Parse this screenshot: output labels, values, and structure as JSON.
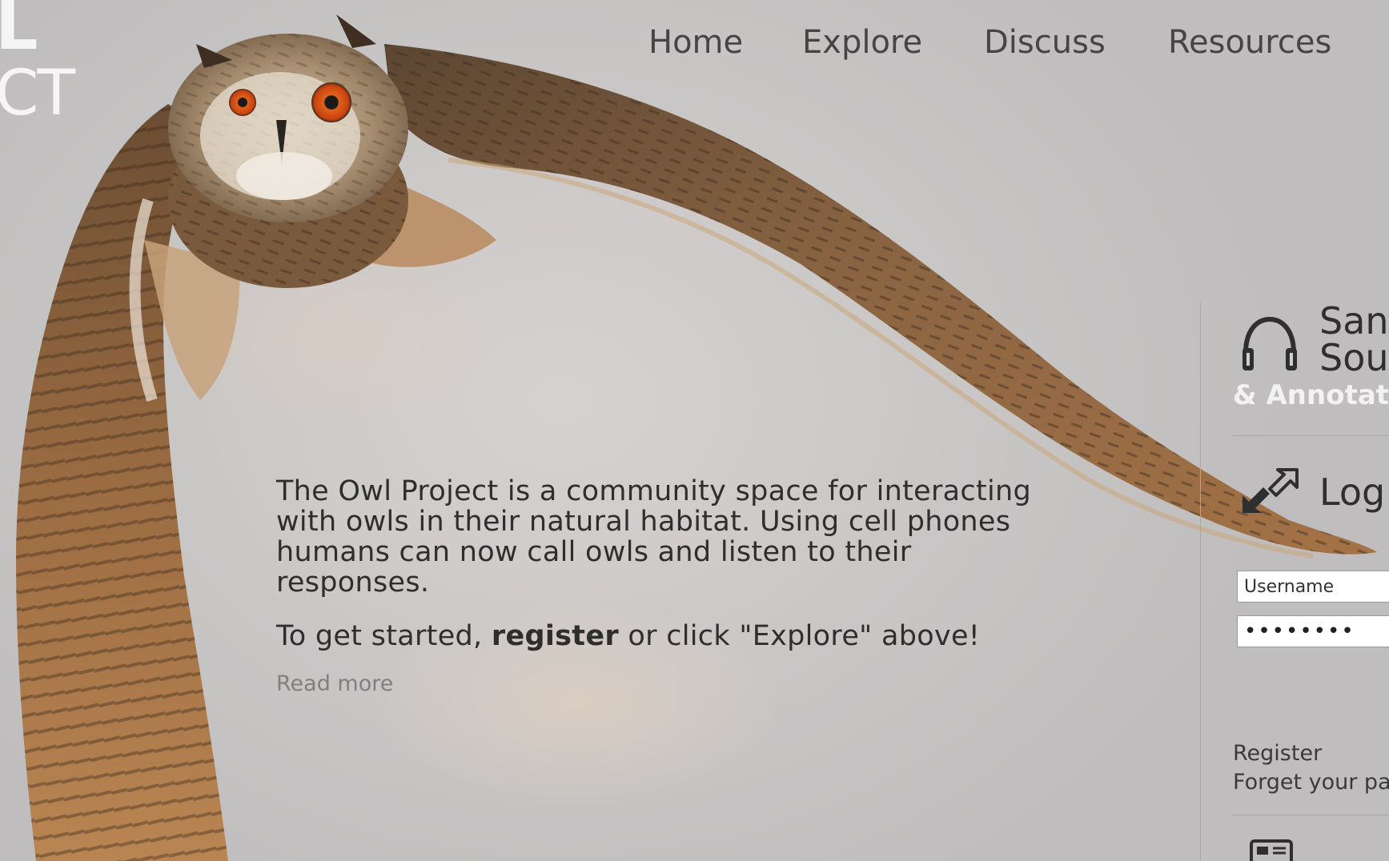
{
  "site": {
    "logo_line1": "L",
    "logo_line2": "CT"
  },
  "nav": {
    "items": [
      {
        "label": "Home"
      },
      {
        "label": "Explore"
      },
      {
        "label": "Discuss"
      },
      {
        "label": "Resources"
      }
    ]
  },
  "intro": {
    "body": "The Owl Project is a community space for interacting with owls in their natural habitat. Using cell phones humans can now call owls and listen to their responses.",
    "cta_prefix": "To get started,",
    "cta_link": "register",
    "cta_suffix": "or click \"Explore\" above!",
    "read_more": "Read more"
  },
  "sidebar": {
    "sounds_heading_line1": "San",
    "sounds_heading_line2": "Sou",
    "sounds_subheading": "& Annotati",
    "login_heading": "Log",
    "username_placeholder": "Username",
    "password_value": "password",
    "register_link": "Register",
    "forgot_link": "Forget your pa"
  },
  "icons": {
    "sounds": "headphones-icon",
    "login": "login-arrows-icon",
    "bottom": "news-icon"
  }
}
